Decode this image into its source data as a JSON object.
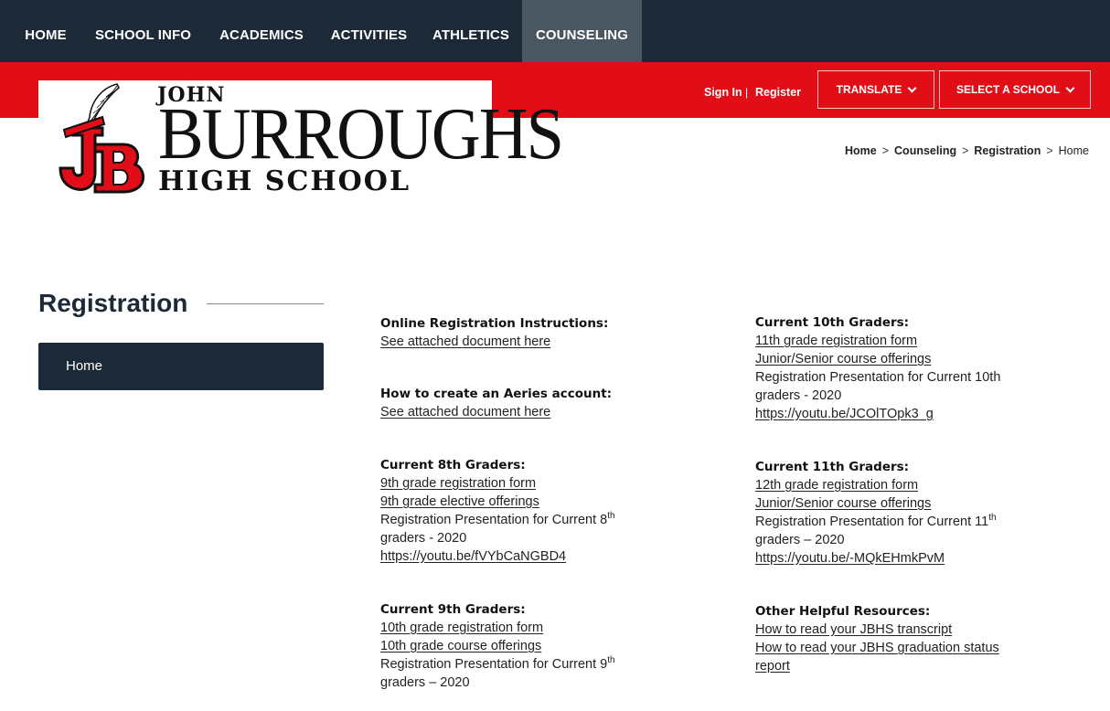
{
  "nav": {
    "items": [
      {
        "label": "HOME",
        "active": false
      },
      {
        "label": "SCHOOL INFO",
        "active": false
      },
      {
        "label": "ACADEMICS",
        "active": false
      },
      {
        "label": "ACTIVITIES",
        "active": false
      },
      {
        "label": "ATHLETICS",
        "active": false
      },
      {
        "label": "COUNSELING",
        "active": true
      }
    ]
  },
  "utility": {
    "sign_in": "Sign In",
    "separator": "|",
    "register": "Register",
    "translate": "TRANSLATE",
    "select_school": "SELECT A SCHOOL"
  },
  "logo": {
    "line1": "JOHN",
    "line2": "BURROUGHS",
    "line3": "HIGH SCHOOL",
    "monogram": "JB"
  },
  "breadcrumb": [
    "Home",
    "Counseling",
    "Registration",
    "Home"
  ],
  "sidebar": {
    "title": "Registration",
    "items": [
      {
        "label": "Home"
      }
    ]
  },
  "content": {
    "online": {
      "heading": "Online Registration Instructions:",
      "link": "See attached document here"
    },
    "aeries": {
      "heading": "How to create an Aeries account:",
      "link": "See attached document here"
    },
    "g8": {
      "heading": "Current 8th Graders:",
      "link1": "9th grade registration form",
      "link2": "9th grade elective offerings",
      "pres_a": "Registration Presentation for Current 8",
      "sup": "th",
      "pres_b": "graders - 2020",
      "url": "https://youtu.be/fVYbCaNGBD4"
    },
    "g9": {
      "heading": "Current 9th Graders:",
      "link1": "10th grade registration form",
      "link2": "10th grade course offerings",
      "pres_a": "Registration Presentation for Current 9",
      "sup": "th",
      "pres_b": "graders – 2020"
    },
    "g10": {
      "heading": "Current 10th Graders:",
      "link1": "11th grade registration form",
      "link2": "Junior/Senior course offerings",
      "pres_a": "Registration Presentation for Current 10th",
      "pres_b": "graders - 2020",
      "url": "https://youtu.be/JCOlTOpk3_g"
    },
    "g11": {
      "heading": "Current 11th Graders:",
      "link1": "12th grade registration form",
      "link2": "Junior/Senior course offerings",
      "pres_a": "Registration Presentation for Current 11",
      "sup": "th",
      "pres_b": "graders – 2020",
      "url": "https://youtu.be/-MQkEHmkPvM"
    },
    "other": {
      "heading": "Other Helpful Resources:",
      "link1": "How to read your JBHS transcript",
      "link2a": "How to read your JBHS graduation status",
      "link2b": "report"
    }
  },
  "colors": {
    "nav_bg": "#1c2a38",
    "nav_active": "#4a5660",
    "brand_red": "#e10e17"
  }
}
